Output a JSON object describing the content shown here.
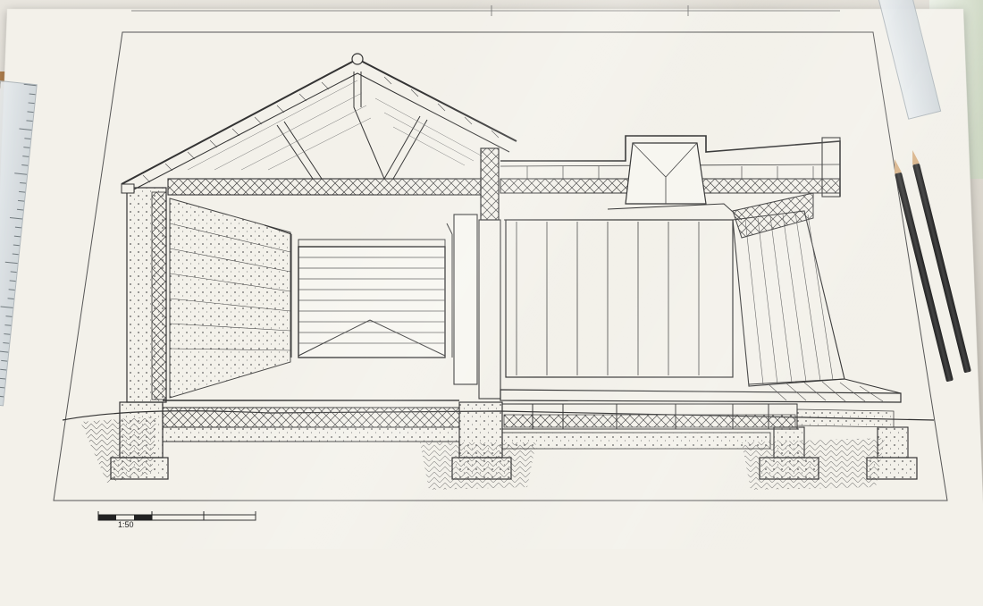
{
  "drawing": {
    "scale_label": "1:50"
  },
  "colors": {
    "ink": "#2a2a2a",
    "paper": "#f3f1ea",
    "desk": "#dcd8cf"
  }
}
